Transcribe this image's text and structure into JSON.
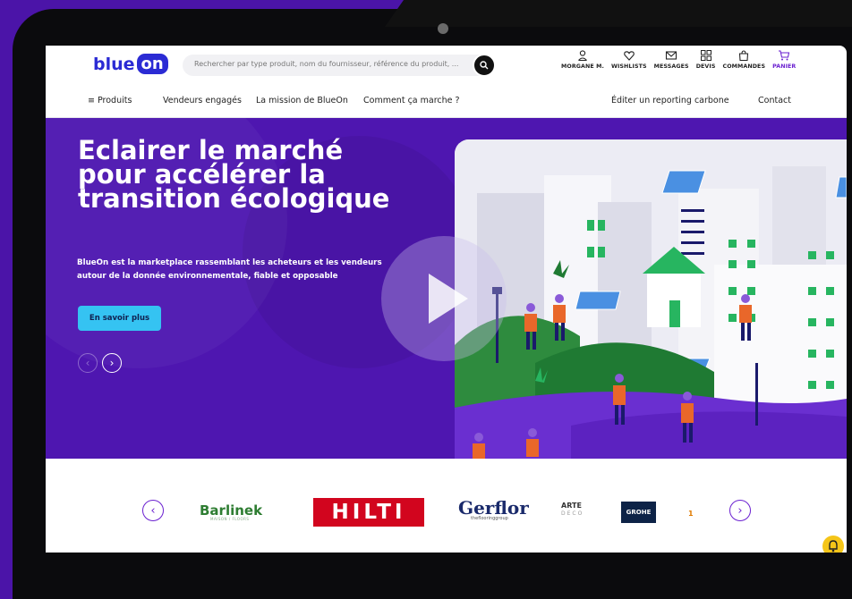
{
  "header": {
    "logo_text_1": "blue",
    "logo_text_2": "on",
    "search_placeholder": "Rechercher par type produit, nom du fournisseur, référence du produit, ...",
    "nav_icons": [
      {
        "label": "MORGANE M.",
        "icon": "user-icon"
      },
      {
        "label": "WISHLISTS",
        "icon": "heart-icon"
      },
      {
        "label": "MESSAGES",
        "icon": "envelope-icon"
      },
      {
        "label": "DEVIS",
        "icon": "grid-icon"
      },
      {
        "label": "COMMANDES",
        "icon": "bag-icon"
      },
      {
        "label": "PANIER",
        "icon": "cart-icon"
      }
    ],
    "menu": {
      "produits": "≡ Produits",
      "vendeurs": "Vendeurs engagés",
      "mission": "La mission de BlueOn",
      "comment": "Comment ça marche ?",
      "reporting": "Éditer un reporting carbone",
      "contact": "Contact"
    }
  },
  "hero": {
    "title_lines": [
      "Eclairer le marché",
      "pour accélérer la",
      "transition écologique"
    ],
    "subtitle_lines": [
      "BlueOn est la marketplace rassemblant les acheteurs et les vendeurs",
      "autour de la donnée environnementale, fiable et opposable"
    ],
    "cta_label": "En savoir plus",
    "prev_arrow": "‹",
    "next_arrow": "›"
  },
  "brands": {
    "barlinek": "Barlinek",
    "barlinek_sub": "MAISON / FLOORS",
    "hilti": "HILTI",
    "gerflor": "Gerflor",
    "gerflor_sub": "theflooringgroup",
    "arte_1": "ARTE",
    "arte_2": "DECO",
    "grohe": "GROHE",
    "dot": "1",
    "prev_arrow": "‹",
    "next_arrow": "›"
  },
  "colors": {
    "brand_blue": "#2b2bd4",
    "hero_purple": "#4e16b0",
    "cta_cyan": "#35c3f2",
    "accent_purple": "#6a1fd0"
  }
}
